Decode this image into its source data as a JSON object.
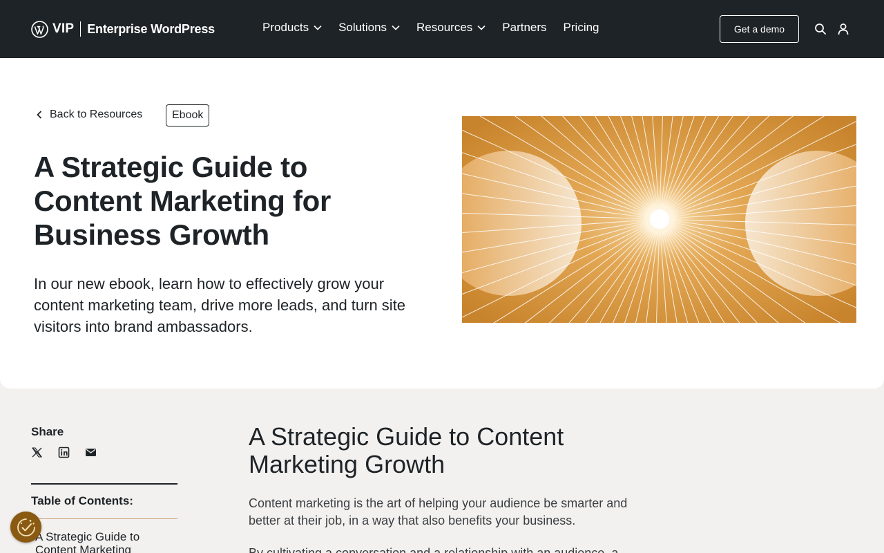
{
  "header": {
    "logo_vip": "VIP",
    "logo_text": "Enterprise WordPress",
    "nav": [
      {
        "label": "Products",
        "dropdown": true
      },
      {
        "label": "Solutions",
        "dropdown": true
      },
      {
        "label": "Resources",
        "dropdown": true
      },
      {
        "label": "Partners",
        "dropdown": false
      },
      {
        "label": "Pricing",
        "dropdown": false
      }
    ],
    "demo_label": "Get a demo",
    "icons": [
      "search-icon",
      "user-icon"
    ]
  },
  "hero": {
    "back_label": "Back to Resources",
    "tag_label": "Ebook",
    "title": "A Strategic Guide to Content Marketing for Business Growth",
    "description": "In our new ebook, learn how to effectively grow your content marketing team, drive more leads, and turn site visitors into brand ambassadors."
  },
  "sidebar": {
    "share_label": "Share",
    "share_icons": [
      "x-icon",
      "linkedin-icon",
      "email-icon"
    ],
    "toc_label": "Table of Contents:",
    "toc_items": [
      "A Strategic Guide to Content Marketing"
    ]
  },
  "article": {
    "title": "A Strategic Guide to Content Marketing Growth",
    "p1": "Content marketing is the art of helping your audience be smarter and better at their job, in a way that also benefits your business.",
    "p2": "By cultivating a conversation and a relationship with an audience, a"
  },
  "colors": {
    "header_bg": "#1e2327",
    "hero_bg": "#ffffff",
    "content_bg": "#f3f1ef",
    "accent_orange": "#d9973f",
    "cookie_bg": "#8a5a12"
  }
}
